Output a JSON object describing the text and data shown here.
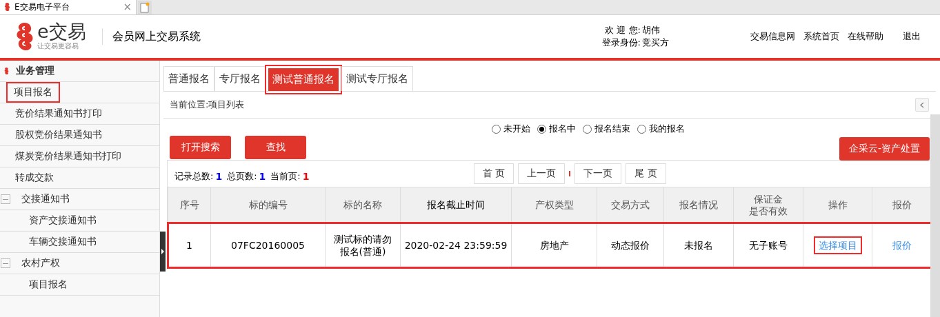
{
  "browser_tab": {
    "title": "E交易电子平台",
    "close": "×"
  },
  "header": {
    "logo_text": "e交易",
    "logo_slogan": "让交易更容易",
    "system_name": "会员网上交易系统",
    "welcome_label": "欢 迎 您:",
    "user": "胡伟",
    "role_label": "登录身份:",
    "role": "竞买方",
    "links": [
      "交易信息网",
      "系统首页",
      "在线帮助",
      "退出"
    ]
  },
  "sidebar": {
    "title": "业务管理",
    "items": [
      {
        "label": "项目报名",
        "highlighted": true
      },
      {
        "label": "竞价结果通知书打印",
        "highlighted": false
      },
      {
        "label": "股权竞价结果通知书",
        "highlighted": false
      },
      {
        "label": "煤炭竞价结果通知书打印",
        "highlighted": false
      },
      {
        "label": "转成交款",
        "highlighted": false
      },
      {
        "label": "交接通知书",
        "highlighted": false,
        "expanded": true,
        "children": [
          {
            "label": "资产交接通知书",
            "highlighted": false
          },
          {
            "label": "车辆交接通知书",
            "highlighted": false
          }
        ]
      },
      {
        "label": "农村产权",
        "highlighted": false,
        "expanded": true,
        "children": [
          {
            "label": "项目报名",
            "highlighted": false
          }
        ]
      }
    ]
  },
  "tabs": [
    {
      "label": "普通报名",
      "selected": false,
      "highlighted": false
    },
    {
      "label": "专厅报名",
      "selected": false,
      "highlighted": false
    },
    {
      "label": "测试普通报名",
      "selected": true,
      "highlighted": true
    },
    {
      "label": "测试专厅报名",
      "selected": false,
      "highlighted": false
    }
  ],
  "breadcrumb": "当前位置:项目列表",
  "filters": [
    {
      "label": "未开始",
      "selected": false
    },
    {
      "label": "报名中",
      "selected": true
    },
    {
      "label": "报名结束",
      "selected": false
    },
    {
      "label": "我的报名",
      "selected": false
    }
  ],
  "buttons": [
    "打开搜索",
    "查找"
  ],
  "side_button": "企采云-资产处置",
  "stats": [
    {
      "label": "记录总数:",
      "value": "1",
      "color": "#0000ff"
    },
    {
      "label": "总页数:",
      "value": "1",
      "color": "#0000ff"
    },
    {
      "label": "当前页:",
      "value": "1",
      "color": "#ff0000"
    }
  ],
  "pager": [
    "首 页",
    "上一页",
    "下一页",
    "尾 页"
  ],
  "table": {
    "columns": [
      {
        "label": "序号"
      },
      {
        "label": "标的编号"
      },
      {
        "label": "标的名称"
      },
      {
        "label": "报名截止时间"
      },
      {
        "label": "产权类型"
      },
      {
        "label": "交易方式"
      },
      {
        "label": "报名情况"
      },
      {
        "label": "保证金",
        "label_line_2": "是否有效"
      },
      {
        "label": "操作"
      },
      {
        "label": "报价"
      }
    ],
    "rows": [
      {
        "highlighted": true,
        "cells": [
          {
            "text": "1",
            "kind": "text"
          },
          {
            "text": "07FC20160005",
            "kind": "text"
          },
          {
            "text": "测试标的请勿",
            "text_line_2": "报名(普通)",
            "kind": "text"
          },
          {
            "text": "2020-02-24 23:59:59",
            "kind": "text"
          },
          {
            "text": "房地产",
            "kind": "text"
          },
          {
            "text": "动态报价",
            "kind": "text"
          },
          {
            "text": "未报名",
            "kind": "text"
          },
          {
            "text": "无子账号",
            "kind": "text"
          },
          {
            "text": "选择项目",
            "kind": "link",
            "highlighted": true
          },
          {
            "text": "报价",
            "kind": "link",
            "highlighted": false
          }
        ]
      }
    ]
  }
}
